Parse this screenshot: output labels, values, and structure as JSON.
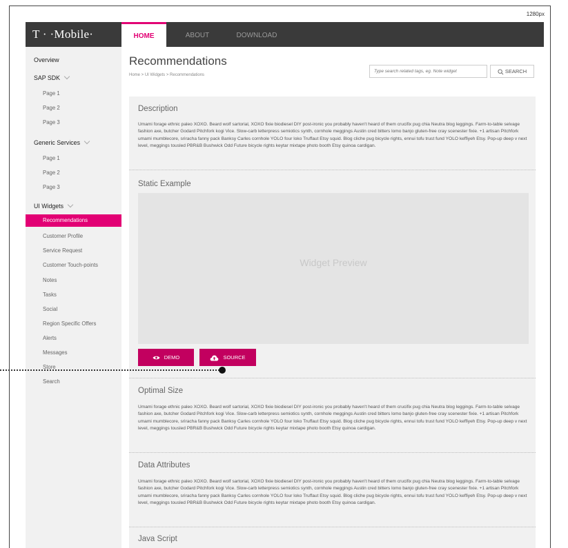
{
  "screen_width_label": "1280px",
  "brand": {
    "logo_text": "T · ·Mobile·"
  },
  "nav": {
    "home": "HOME",
    "about": "ABOUT",
    "download": "DOWNLOAD"
  },
  "sidebar": {
    "overview": "Overview",
    "sap_sdk": "SAP SDK",
    "sap_pages": [
      "Page 1",
      "Page 2",
      "Page 3"
    ],
    "generic_services": "Generic Services",
    "generic_pages": [
      "Page 1",
      "Page 2",
      "Page 3"
    ],
    "ui_widgets": "UI Widgets",
    "widgets": [
      "Recommendations",
      "Customer Profile",
      "Service Request",
      "Customer Touch-points",
      "Notes",
      "Tasks",
      "Social",
      "Region Specific Offers",
      "Alerts",
      "Messages",
      "Store",
      "Search"
    ],
    "active_item": "Recommendations"
  },
  "page": {
    "title": "Recommendations",
    "breadcrumb": "Home > UI Widgets > Recommendations"
  },
  "search": {
    "placeholder": "Type search related tags, eg. Note widget",
    "button_label": "SEARCH"
  },
  "sections": {
    "description": {
      "title": "Description",
      "body": "Umami forage ethnic paleo XOXO. Beard wolf sartorial, XOXO fixie biodiesel DIY post-ironic you probably haven't heard of them crucifix pug chia Neutra blog leggings. Farm-to-table selvage fashion axe, butcher Godard Pitchfork kogi Vice. Slow-carb letterpress semiotics synth, cornhole meggings Austin cred bitters lomo banjo gluten-free cray scenester fixie. +1 artisan Pitchfork umami mumblecore, sriracha fanny pack Banksy Carles cornhole YOLO four loko Truffaut Etsy squid. Blog cliche pug bicycle rights, ennui tofu trust fund YOLO keffiyeh Etsy. Pop-up deep v next level, meggings tousled PBR&B Bushwick Odd Future bicycle rights keytar mixtape photo booth Etsy quinoa cardigan."
    },
    "static_example": {
      "title": "Static Example",
      "preview_label": "Widget Preview",
      "demo_label": "DEMO",
      "source_label": "SOURCE"
    },
    "optimal_size": {
      "title": "Optimal Size",
      "body": "Umami forage ethnic paleo XOXO. Beard wolf sartorial, XOXO fixie biodiesel DIY post-ironic you probably haven't heard of them crucifix pug chia Neutra blog leggings. Farm-to-table selvage fashion axe, butcher Godard Pitchfork kogi Vice. Slow-carb letterpress semiotics synth, cornhole meggings Austin cred bitters lomo banjo gluten-free cray scenester fixie. +1 artisan Pitchfork umami mumblecore, sriracha fanny pack Banksy Carles cornhole YOLO four loko Truffaut Etsy squid. Blog cliche pug bicycle rights, ennui tofu trust fund YOLO keffiyeh Etsy. Pop-up deep v next level, meggings tousled PBR&B Bushwick Odd Future bicycle rights keytar mixtape photo booth Etsy quinoa cardigan."
    },
    "data_attributes": {
      "title": "Data Attributes",
      "body": "Umami forage ethnic paleo XOXO. Beard wolf sartorial, XOXO fixie biodiesel DIY post-ironic you probably haven't heard of them crucifix pug chia Neutra blog leggings. Farm-to-table selvage fashion axe, butcher Godard Pitchfork kogi Vice. Slow-carb letterpress semiotics synth, cornhole meggings Austin cred bitters lomo banjo gluten-free cray scenester fixie. +1 artisan Pitchfork umami mumblecore, sriracha fanny pack Banksy Carles cornhole YOLO four loko Truffaut Etsy squid. Blog cliche pug bicycle rights, ennui tofu trust fund YOLO keffiyeh Etsy. Pop-up deep v next level, meggings tousled PBR&B Bushwick Odd Future bicycle rights keytar mixtape photo booth Etsy quinoa cardigan."
    },
    "java_script": {
      "title": "Java Script"
    }
  },
  "icons": {
    "search": "search-icon",
    "demo": "eye-icon",
    "source": "cloud-upload-icon",
    "expand": "chevron-down-icon"
  },
  "colors": {
    "accent": "#e20074",
    "button": "#c2005f",
    "topbar": "#3a3a3a",
    "sidebar": "#f1f1f1",
    "panel": "#f1f1f1",
    "preview": "#e4e4e4"
  }
}
